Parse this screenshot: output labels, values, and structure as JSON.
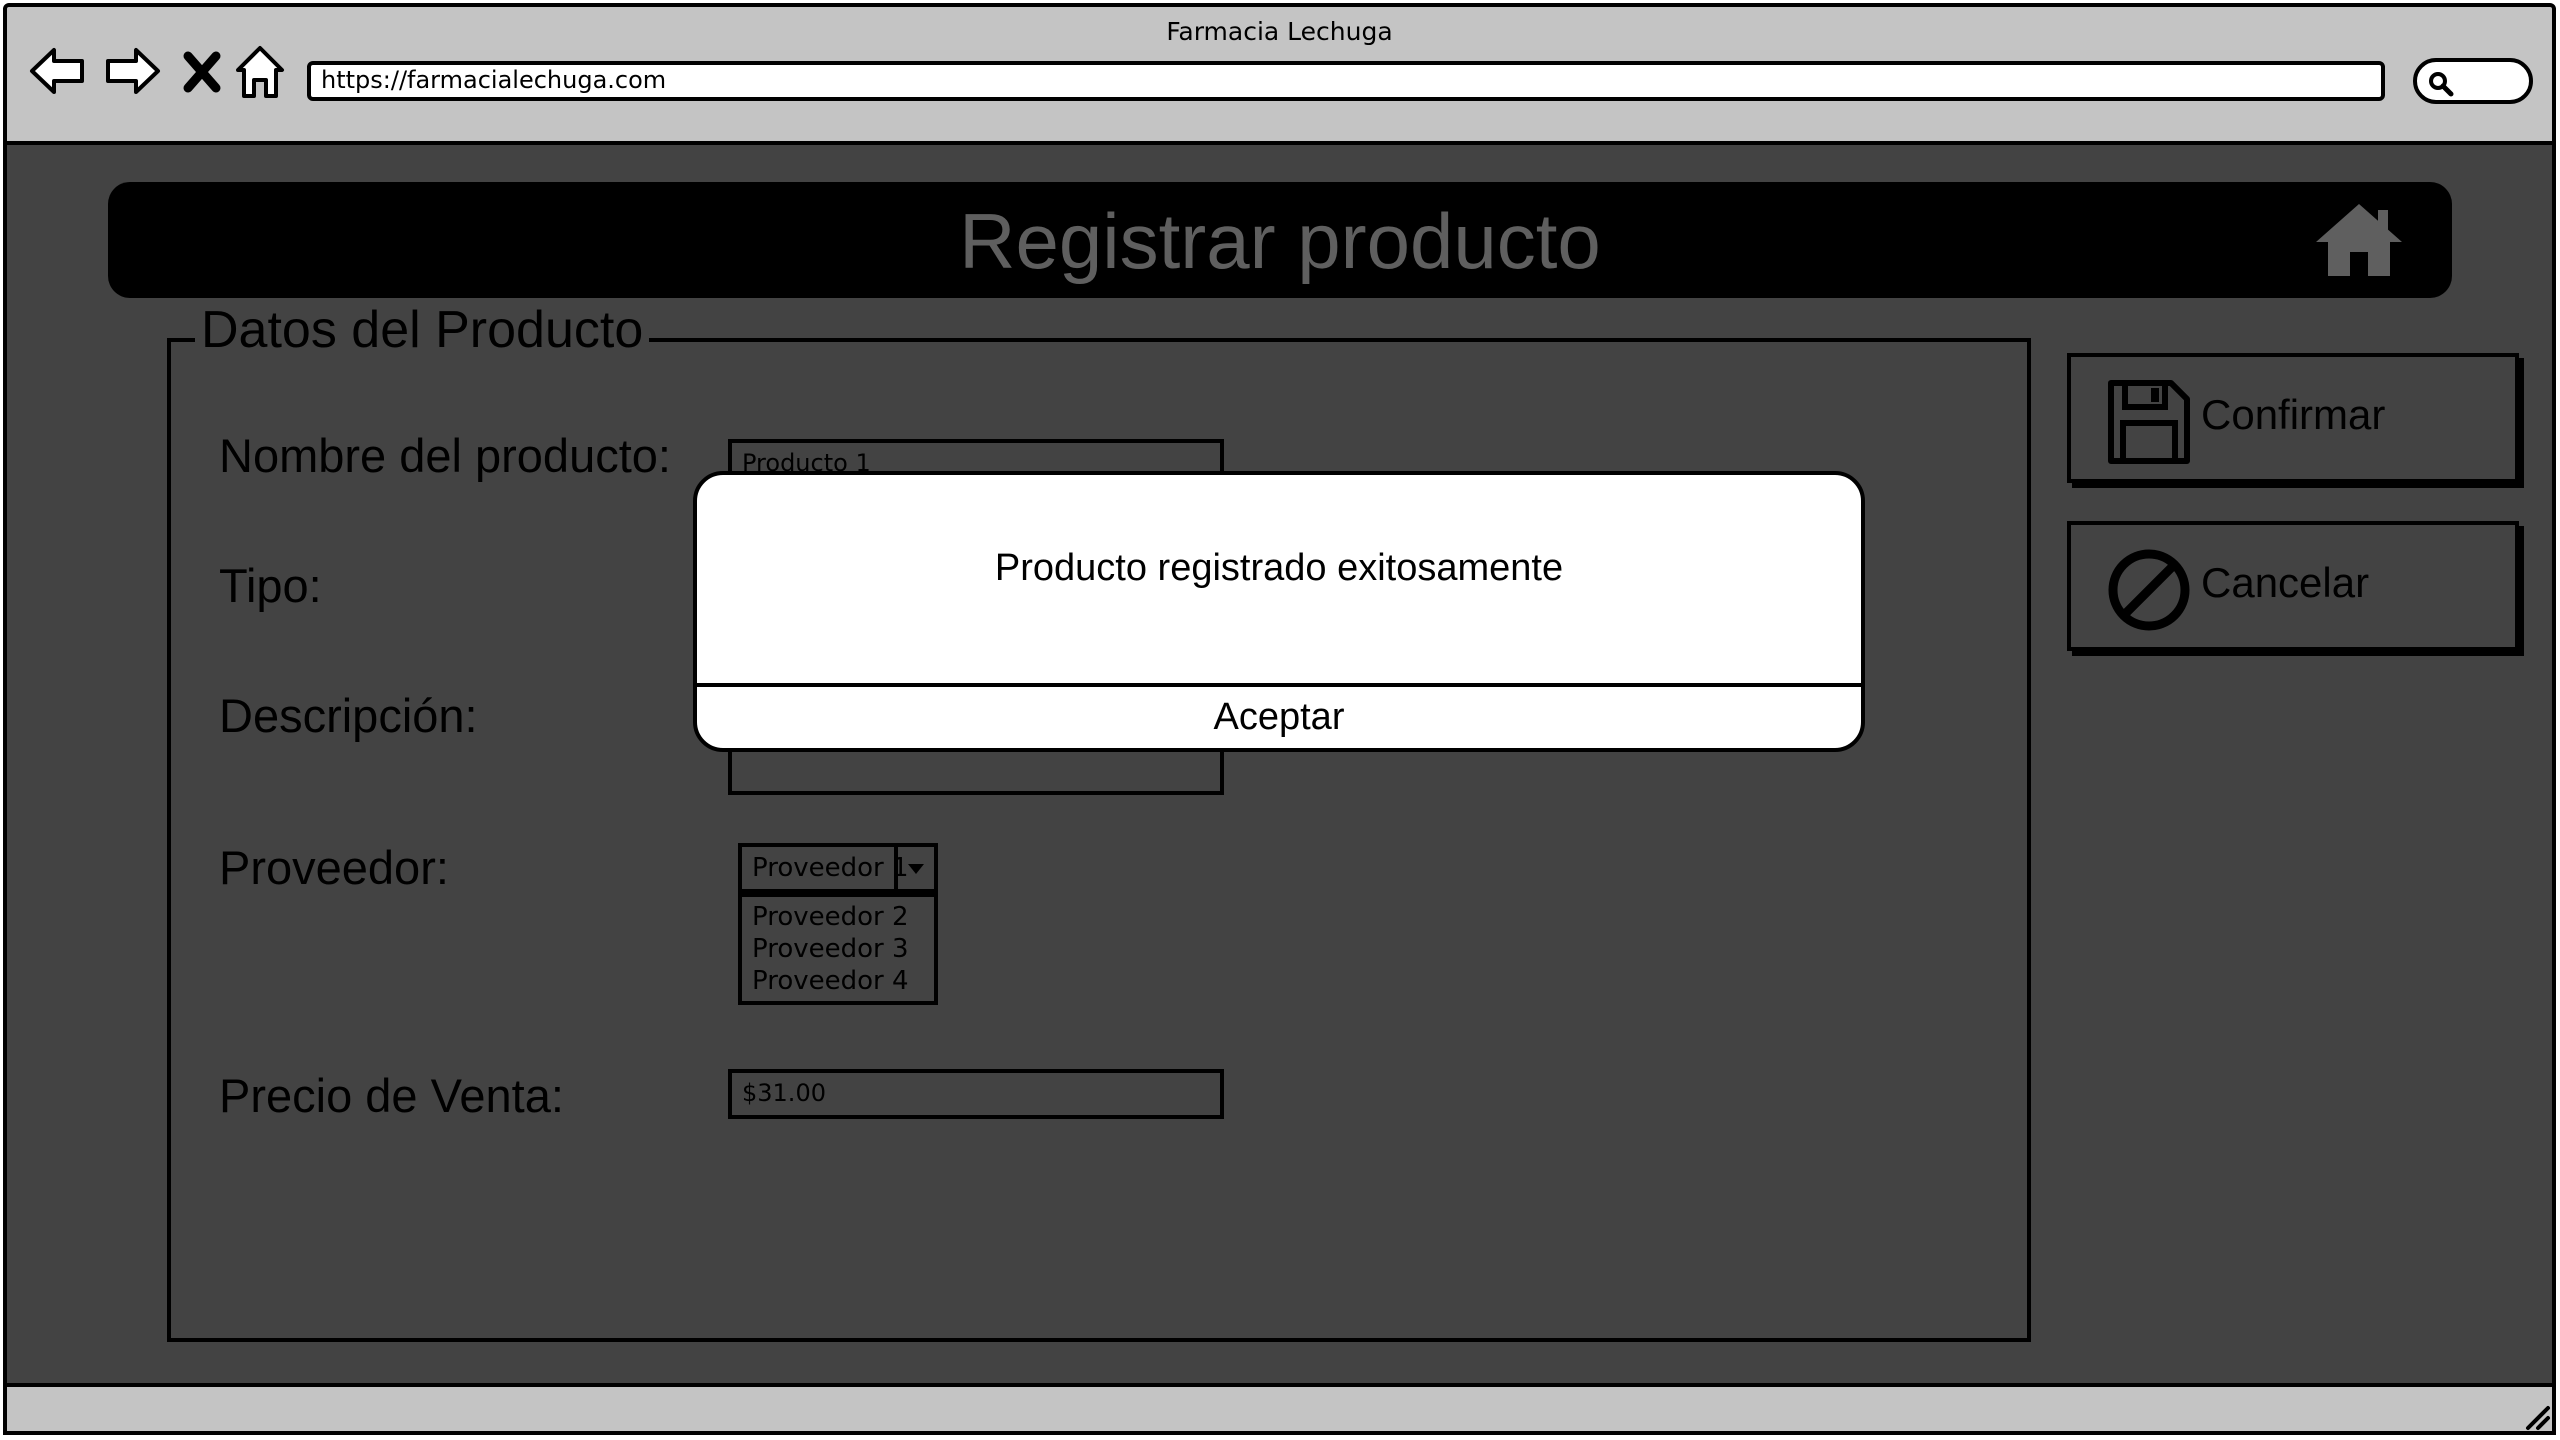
{
  "browser": {
    "window_title": "Farmacia Lechuga",
    "url": "https://farmacialechuga.com"
  },
  "header": {
    "title": "Registrar producto"
  },
  "form": {
    "legend": "Datos del Producto",
    "nombre_label": "Nombre del producto:",
    "nombre_value": "Producto 1",
    "tipo_label": "Tipo:",
    "descripcion_label": "Descripción:",
    "proveedor_label": "Proveedor:",
    "proveedor_selected": "Proveedor 1",
    "proveedor_options": [
      "Proveedor 2",
      "Proveedor 3",
      "Proveedor 4"
    ],
    "precio_label": "Precio de Venta:",
    "precio_value": "$31.00"
  },
  "actions": {
    "confirm_label": "Confirmar",
    "cancel_label": "Cancelar"
  },
  "dialog": {
    "message": "Producto registrado exitosamente",
    "ok_label": "Aceptar"
  },
  "icons": {
    "back": "back-arrow-icon",
    "forward": "forward-arrow-icon",
    "stop": "close-x-icon",
    "home": "home-icon",
    "search": "search-icon",
    "save": "floppy-disk-icon",
    "cancel": "prohibited-icon"
  }
}
